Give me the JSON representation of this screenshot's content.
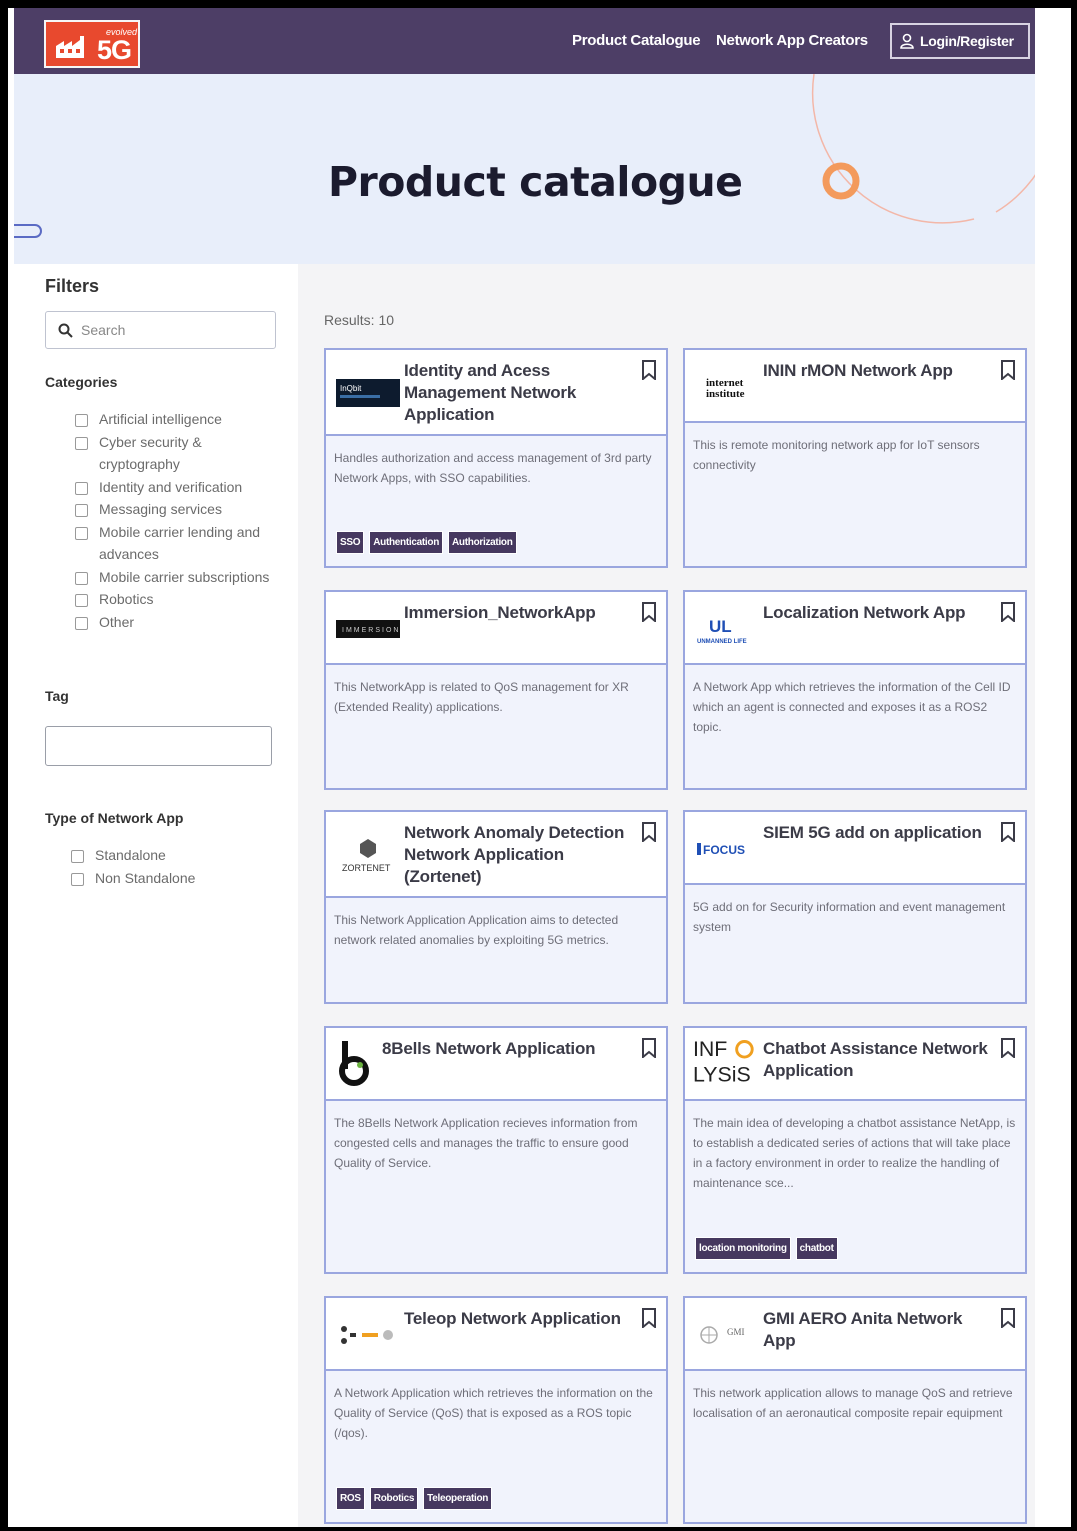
{
  "header": {
    "logo": {
      "sub": "evolved",
      "text": "5G",
      "color": "#e8492e"
    },
    "nav": [
      "Product Catalogue",
      "Network App Creators"
    ],
    "login_label": "Login/Register",
    "bg_color": "#4d3e66"
  },
  "hero": {
    "title": "Product catalogue"
  },
  "sidebar": {
    "filters_title": "Filters",
    "search_placeholder": "Search",
    "categories_title": "Categories",
    "categories": [
      "Artificial intelligence",
      "Cyber security &",
      "cryptography",
      "Identity and verification",
      "Messaging services",
      "Mobile carrier lending and",
      "advances",
      "Mobile carrier subscriptions",
      "Robotics",
      "Other"
    ],
    "tag_title": "Tag",
    "type_title": "Type of Network App",
    "types": [
      "Standalone",
      "Non Standalone"
    ]
  },
  "main": {
    "results_label": "Results: 10",
    "cards": [
      {
        "title": "Identity and Acess Management Network Application",
        "logo_icon": "inqbit-logo",
        "desc": "Handles authorization and access management of 3rd party Network Apps, with SSO capabilities.",
        "tags": [
          "SSO",
          "Authentication",
          "Authorization"
        ]
      },
      {
        "title": "ININ rMON Network App",
        "logo_icon": "internet-institute-logo",
        "desc": "This is remote monitoring network app for IoT sensors connectivity",
        "tags": []
      },
      {
        "title": "Immersion_NetworkApp",
        "logo_icon": "immersion-logo",
        "desc": "This NetworkApp is related to QoS management for XR (Extended Reality) applications.",
        "tags": []
      },
      {
        "title": "Localization Network App",
        "logo_icon": "unmanned-life-logo",
        "desc": "A Network App which retrieves the information of the Cell ID which an agent is connected and exposes it as a ROS2 topic.",
        "tags": []
      },
      {
        "title": "Network Anomaly Detection Network Application (Zortenet)",
        "logo_icon": "zortenet-logo",
        "desc": "This Network Application Application aims to detected network related anomalies by exploiting 5G metrics.",
        "tags": []
      },
      {
        "title": "SIEM 5G add on application",
        "logo_icon": "focus-logo",
        "desc": "5G add on for Security information and event management system",
        "tags": []
      },
      {
        "title": "8Bells Network Application",
        "logo_icon": "8bells-logo",
        "desc": "The 8Bells Network Application recieves information from congested cells and manages the traffic to ensure good Quality of Service.",
        "tags": []
      },
      {
        "title": "Chatbot Assistance Network Application",
        "logo_icon": "infolysis-logo",
        "desc": "The main idea of developing a chatbot assistance NetApp, is to establish a dedicated series of actions that will take place in a factory environment in order to realize the handling of maintenance sce...",
        "tags": [
          "location monitoring",
          "chatbot"
        ]
      },
      {
        "title": "Teleop Network Application",
        "logo_icon": "teleop-logo",
        "desc": "A Network Application which retrieves the information on the Quality of Service (QoS) that is exposed as a ROS topic (/qos).",
        "tags": [
          "ROS",
          "Robotics",
          "Teleoperation"
        ]
      },
      {
        "title": "GMI AERO Anita Network App",
        "logo_icon": "gmi-aero-logo",
        "desc": "This network application allows to manage QoS and retrieve localisation of an aeronautical composite repair equipment",
        "tags": []
      }
    ]
  },
  "colors": {
    "accent": "#4d3e66",
    "card_border": "#9aa6df",
    "hero_bg": "#e8eefa",
    "deco_orange": "#f39a5c"
  }
}
